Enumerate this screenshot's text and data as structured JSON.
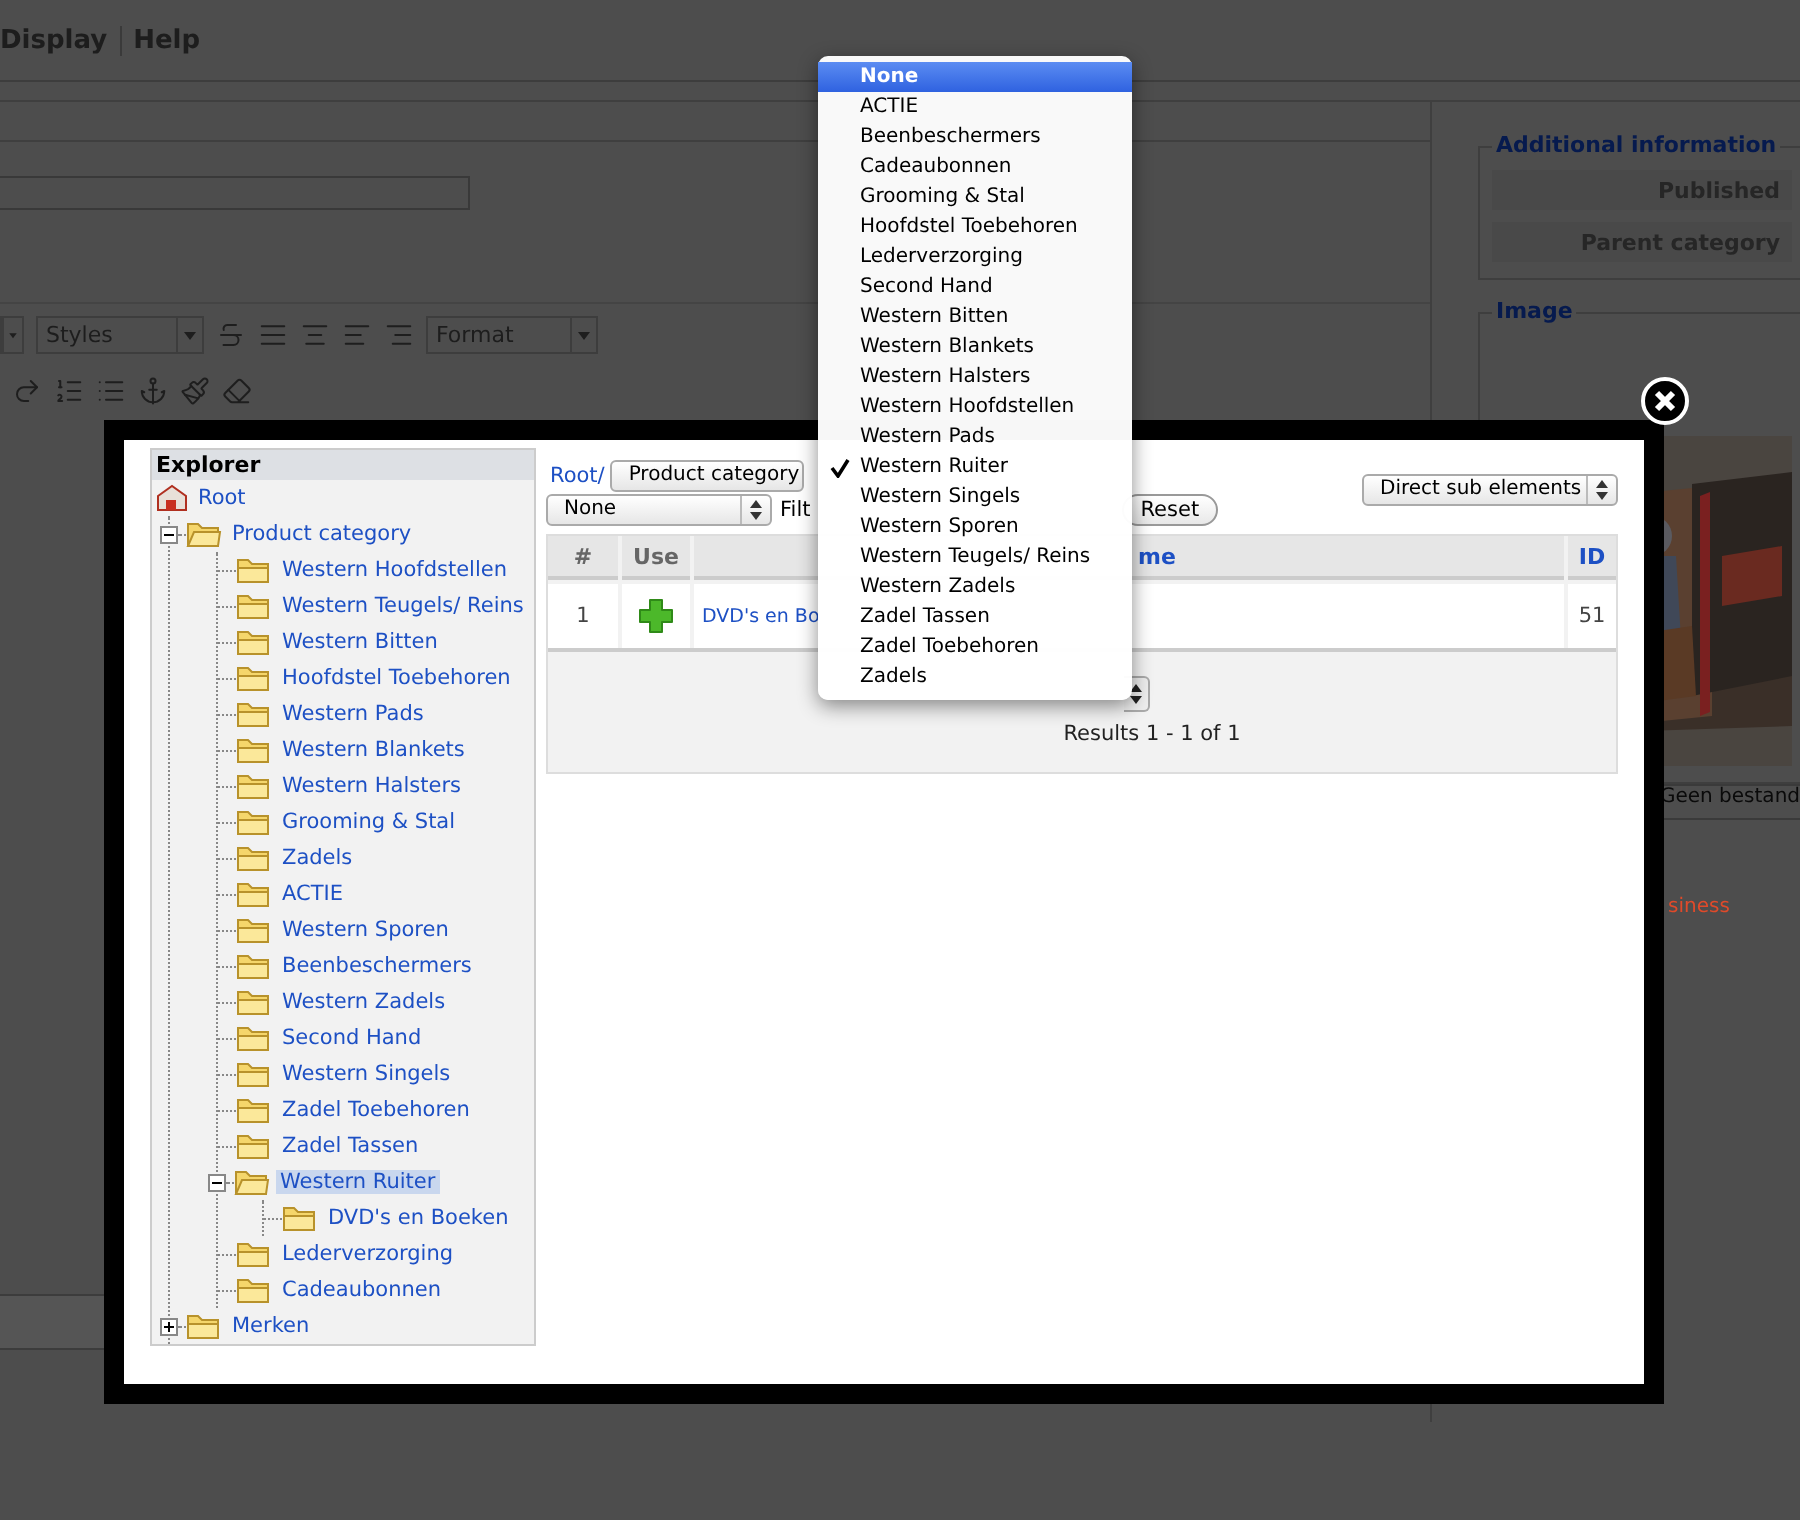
{
  "menu": [
    {
      "label": "Display"
    },
    {
      "label": "Help"
    }
  ],
  "editor_toolbar": {
    "styles": "Styles",
    "format": "Format"
  },
  "sidebar": {
    "sections": [
      {
        "title": "Additional information",
        "fields": [
          "Published",
          "Parent category"
        ]
      },
      {
        "title": "Image",
        "kind": "picture"
      }
    ],
    "file_button": "Geen bestand",
    "note": "siness"
  },
  "dialog": {
    "explorer": {
      "title": "Explorer",
      "root": "Root",
      "tree": [
        {
          "label": "Product category",
          "expanded": true,
          "selected": false,
          "children": [
            {
              "label": "Western Hoofdstellen",
              "selected": false
            },
            {
              "label": "Western Teugels/ Reins",
              "selected": false
            },
            {
              "label": "Western Bitten",
              "selected": false
            },
            {
              "label": "Hoofdstel Toebehoren",
              "selected": false
            },
            {
              "label": "Western Pads",
              "selected": false
            },
            {
              "label": "Western Blankets",
              "selected": false
            },
            {
              "label": "Western Halsters",
              "selected": false
            },
            {
              "label": "Grooming & Stal",
              "selected": false
            },
            {
              "label": "Zadels",
              "selected": false
            },
            {
              "label": "ACTIE",
              "selected": false
            },
            {
              "label": "Western Sporen",
              "selected": false
            },
            {
              "label": "Beenbeschermers",
              "selected": false
            },
            {
              "label": "Western Zadels",
              "selected": false
            },
            {
              "label": "Second Hand",
              "selected": false
            },
            {
              "label": "Western Singels",
              "selected": false
            },
            {
              "label": "Zadel Toebehoren",
              "selected": false
            },
            {
              "label": "Zadel Tassen",
              "selected": false
            },
            {
              "label": "Western Ruiter",
              "expanded": true,
              "selected": true,
              "children": [
                {
                  "label": "DVD's en Boeken",
                  "selected": false
                }
              ]
            },
            {
              "label": "Lederverzorging",
              "selected": false
            },
            {
              "label": "Cadeaubonnen",
              "selected": false
            }
          ]
        },
        {
          "label": "Merken",
          "expanded": false,
          "selected": false
        }
      ]
    },
    "breadcrumb": {
      "root": "Root/",
      "segment": "Product category"
    },
    "type_select": "None",
    "filter_label": "Filt",
    "reset_button": "Reset",
    "scope_select": "Direct sub elements",
    "table": {
      "columns": [
        "#",
        "Use",
        "me",
        "ID"
      ],
      "rows": [
        {
          "number": "1",
          "name": "DVD's en Bo",
          "id": "51"
        }
      ]
    },
    "results": "Results 1 - 1 of 1"
  },
  "dropdown": {
    "options": [
      {
        "label": "None",
        "highlighted": true,
        "checked": false
      },
      {
        "label": "ACTIE",
        "highlighted": false,
        "checked": false
      },
      {
        "label": "Beenbeschermers",
        "highlighted": false,
        "checked": false
      },
      {
        "label": "Cadeaubonnen",
        "highlighted": false,
        "checked": false
      },
      {
        "label": "Grooming & Stal",
        "highlighted": false,
        "checked": false
      },
      {
        "label": "Hoofdstel Toebehoren",
        "highlighted": false,
        "checked": false
      },
      {
        "label": "Lederverzorging",
        "highlighted": false,
        "checked": false
      },
      {
        "label": "Second Hand",
        "highlighted": false,
        "checked": false
      },
      {
        "label": "Western Bitten",
        "highlighted": false,
        "checked": false
      },
      {
        "label": "Western Blankets",
        "highlighted": false,
        "checked": false
      },
      {
        "label": "Western Halsters",
        "highlighted": false,
        "checked": false
      },
      {
        "label": "Western Hoofdstellen",
        "highlighted": false,
        "checked": false
      },
      {
        "label": "Western Pads",
        "highlighted": false,
        "checked": false
      },
      {
        "label": "Western Ruiter",
        "highlighted": false,
        "checked": true
      },
      {
        "label": "Western Singels",
        "highlighted": false,
        "checked": false
      },
      {
        "label": "Western Sporen",
        "highlighted": false,
        "checked": false
      },
      {
        "label": "Western Teugels/ Reins",
        "highlighted": false,
        "checked": false
      },
      {
        "label": "Western Zadels",
        "highlighted": false,
        "checked": false
      },
      {
        "label": "Zadel Tassen",
        "highlighted": false,
        "checked": false
      },
      {
        "label": "Zadel Toebehoren",
        "highlighted": false,
        "checked": false
      },
      {
        "label": "Zadels",
        "highlighted": false,
        "checked": false
      }
    ]
  }
}
